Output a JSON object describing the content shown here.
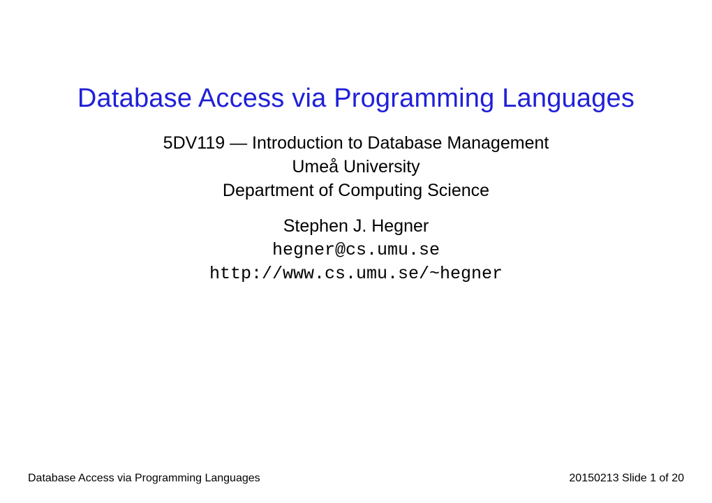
{
  "title": "Database Access via Programming Languages",
  "course": "5DV119 — Introduction to Database Management",
  "university": "Umeå University",
  "department": "Department of Computing Science",
  "author_name": "Stephen J. Hegner",
  "author_email": "hegner@cs.umu.se",
  "author_url": "http://www.cs.umu.se/~hegner",
  "footer": {
    "left": "Database Access via Programming Languages",
    "right": "20150213 Slide 1 of 20"
  }
}
